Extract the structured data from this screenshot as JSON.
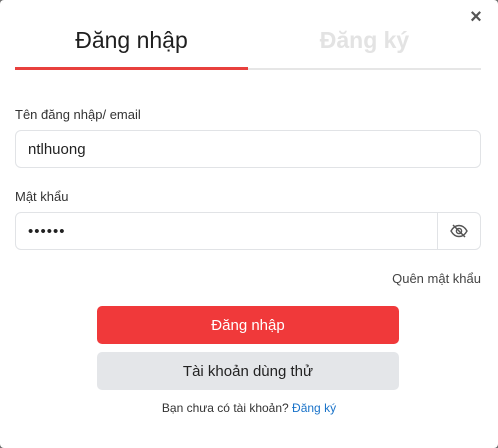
{
  "modal": {
    "close_glyph": "×"
  },
  "tabs": [
    {
      "label": "Đăng nhập",
      "active": true
    },
    {
      "label": "Đăng ký",
      "active": false
    }
  ],
  "username": {
    "label": "Tên đăng nhập/ email",
    "value": "ntlhuong"
  },
  "password": {
    "label": "Mật khẩu",
    "value": "••••••",
    "toggle_icon": "eye-slash-icon"
  },
  "forgot_password": "Quên mật khẩu",
  "login_button": "Đăng nhập",
  "trial_button": "Tài khoản dùng thử",
  "signup": {
    "prompt": "Bạn chưa có tài khoản?",
    "link": "Đăng ký"
  },
  "colors": {
    "accent": "#f0393a",
    "link": "#1a73c9",
    "inactive_tab": "#e3e3e3"
  }
}
